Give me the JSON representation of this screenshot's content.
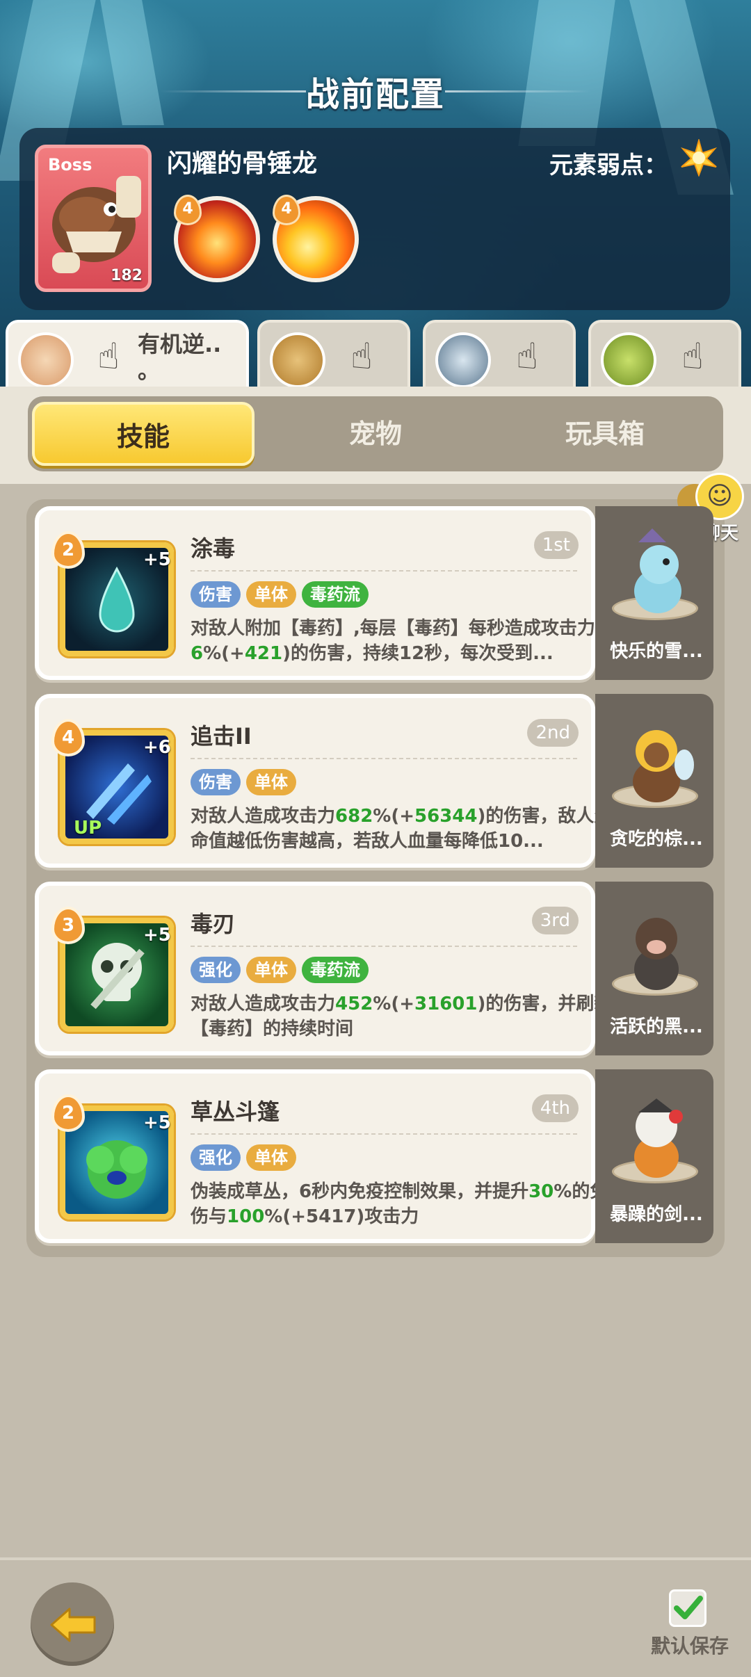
{
  "header": {
    "title": "战前配置"
  },
  "boss": {
    "tag": "Boss",
    "level": "182",
    "name": "闪耀的骨锤龙",
    "weakness_label": "元素弱点：",
    "skills": [
      {
        "level": "4",
        "icon": "fire-bird-icon"
      },
      {
        "level": "4",
        "icon": "fire-slash-icon"
      }
    ]
  },
  "pet_tabs": [
    {
      "label": "有机逆..\n。",
      "icon": "hand-pointer-icon"
    },
    {
      "label": "",
      "icon": "hand-pointer-icon"
    },
    {
      "label": "",
      "icon": "hand-pointer-icon"
    },
    {
      "label": "",
      "icon": "hand-pointer-icon"
    }
  ],
  "segments": {
    "skills": "技能",
    "pets": "宠物",
    "toybox": "玩具箱",
    "active": "skills"
  },
  "chat": {
    "label": "聊天"
  },
  "skills": [
    {
      "name": "涂毒",
      "level": "2",
      "plus": "+5",
      "rank": "1st",
      "tags": [
        "伤害",
        "单体",
        "毒药流"
      ],
      "desc_a": "对敌人附加【毒药】,每层【毒药】每秒造成攻击力",
      "hl1": "6",
      "desc_b": "%(+",
      "hl2": "421",
      "desc_c": ")的伤害，持续12秒，每次受到...",
      "pet": "快乐的雪..."
    },
    {
      "name": "追击II",
      "level": "4",
      "plus": "+6",
      "rank": "2nd",
      "up": "UP",
      "tags": [
        "伤害",
        "单体"
      ],
      "desc_a": "对敌人造成攻击力",
      "hl1": "682",
      "desc_b": "%(+",
      "hl2": "56344",
      "desc_c": ")的伤害，敌人生命值越低伤害越高，若敌人血量每降低10...",
      "pet": "贪吃的棕..."
    },
    {
      "name": "毒刃",
      "level": "3",
      "plus": "+5",
      "rank": "3rd",
      "tags": [
        "强化",
        "单体",
        "毒药流"
      ],
      "desc_a": "对敌人造成攻击力",
      "hl1": "452",
      "desc_b": "%(+",
      "hl2": "31601",
      "desc_c": ")的伤害，并刷新【毒药】的持续时间",
      "pet": "活跃的黑..."
    },
    {
      "name": "草丛斗篷",
      "level": "2",
      "plus": "+5",
      "rank": "4th",
      "tags": [
        "强化",
        "单体"
      ],
      "desc_a": "伪装成草丛，6秒内免疫控制效果，并提升",
      "hl1": "30",
      "desc_b": "%的免伤与",
      "hl2": "100",
      "desc_c": "%(+5417)攻击力",
      "pet": "暴躁的剑..."
    }
  ],
  "footer": {
    "save_label": "默认保存"
  },
  "colors": {
    "accent_yellow": "#f7c930",
    "highlight_green": "#29a12b",
    "panel_dark": "#122a3e"
  }
}
